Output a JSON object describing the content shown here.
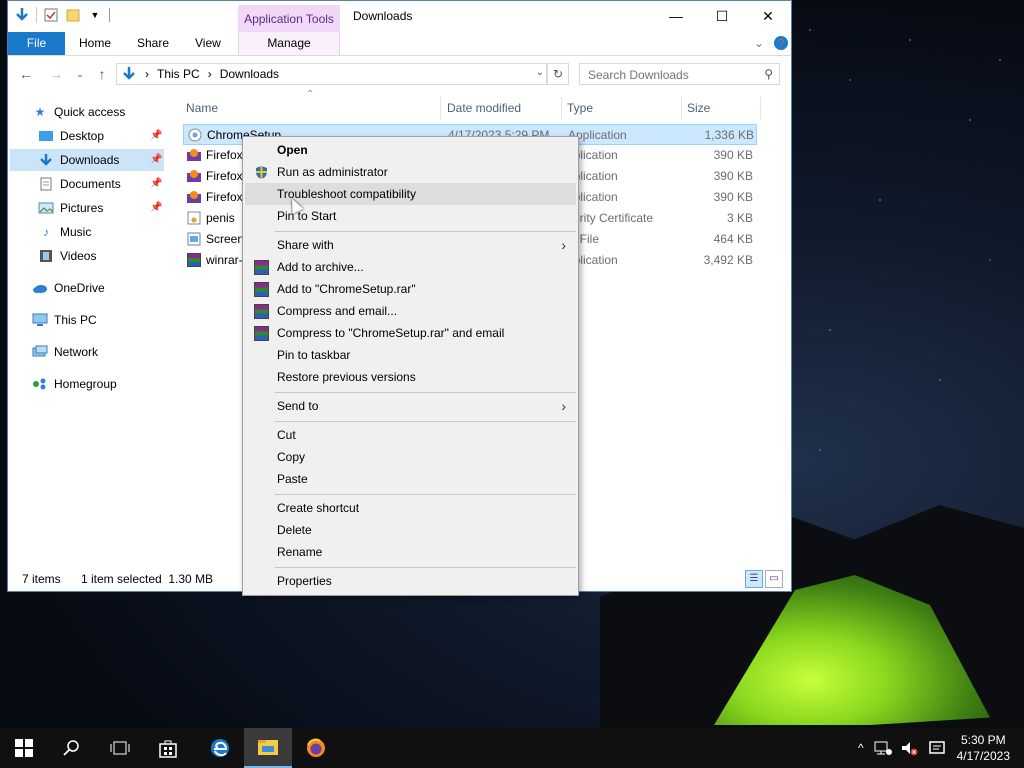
{
  "window": {
    "title": "Downloads",
    "app_tools_label": "Application Tools",
    "controls": {
      "minimize": "—",
      "maximize": "☐",
      "close": "✕"
    }
  },
  "ribbon": {
    "file_tab": "File",
    "tabs": [
      "Home",
      "Share",
      "View"
    ],
    "manage_tab": "Manage"
  },
  "address": {
    "crumbs": [
      "This PC",
      "Downloads"
    ],
    "search_placeholder": "Search Downloads"
  },
  "nav_pane": {
    "quick_access": "Quick access",
    "quick_items": [
      "Desktop",
      "Downloads",
      "Documents",
      "Pictures",
      "Music",
      "Videos"
    ],
    "onedrive": "OneDrive",
    "this_pc": "This PC",
    "network": "Network",
    "homegroup": "Homegroup"
  },
  "columns": {
    "name": "Name",
    "date": "Date modified",
    "type": "Type",
    "size": "Size"
  },
  "files": [
    {
      "name": "ChromeSetup",
      "date": "4/17/2023 5:29 PM",
      "type": "Application",
      "size": "1,336 KB"
    },
    {
      "name": "Firefox",
      "date": "",
      "type": "pplication",
      "size": "390 KB"
    },
    {
      "name": "Firefox",
      "date": "",
      "type": "pplication",
      "size": "390 KB"
    },
    {
      "name": "Firefox",
      "date": "",
      "type": "pplication",
      "size": "390 KB"
    },
    {
      "name": "penis",
      "date": "",
      "type": "curity Certificate",
      "size": "3 KB"
    },
    {
      "name": "Screen",
      "date": "",
      "type": "G File",
      "size": "464 KB"
    },
    {
      "name": "winrar-",
      "date": "",
      "type": "pplication",
      "size": "3,492 KB"
    }
  ],
  "status": {
    "count": "7 items",
    "selection": "1 item selected  1.30 MB"
  },
  "context_menu": {
    "open": "Open",
    "run_admin": "Run as administrator",
    "troubleshoot": "Troubleshoot compatibility",
    "pin_start": "Pin to Start",
    "share_with": "Share with",
    "add_archive": "Add to archive...",
    "add_rar": "Add to \"ChromeSetup.rar\"",
    "compress_email": "Compress and email...",
    "compress_rar_email": "Compress to \"ChromeSetup.rar\" and email",
    "pin_taskbar": "Pin to taskbar",
    "restore": "Restore previous versions",
    "send_to": "Send to",
    "cut": "Cut",
    "copy": "Copy",
    "paste": "Paste",
    "create_shortcut": "Create shortcut",
    "delete": "Delete",
    "rename": "Rename",
    "properties": "Properties"
  },
  "taskbar": {
    "time": "5:30 PM",
    "date": "4/17/2023"
  },
  "colors": {
    "accent": "#1979ca",
    "selection": "#cce8ff",
    "app_tools": "#f2d8f8"
  }
}
